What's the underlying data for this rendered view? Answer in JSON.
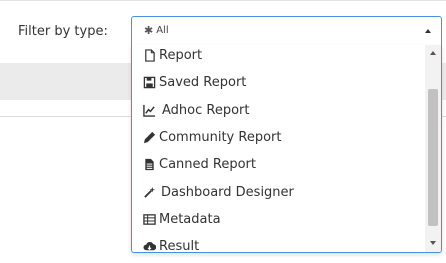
{
  "filter": {
    "label": "Filter by type:",
    "selected": "All",
    "selected_icon": "asterisk-icon"
  },
  "options": [
    {
      "label": "Report",
      "icon": "file-icon"
    },
    {
      "label": "Saved Report",
      "icon": "floppy-disk-icon"
    },
    {
      "label": "Adhoc Report",
      "icon": "line-chart-icon"
    },
    {
      "label": "Community Report",
      "icon": "pencil-icon"
    },
    {
      "label": "Canned Report",
      "icon": "document-icon"
    },
    {
      "label": "Dashboard Designer",
      "icon": "magic-wand-icon"
    },
    {
      "label": "Metadata",
      "icon": "table-icon"
    },
    {
      "label": "Result",
      "icon": "cloud-download-icon"
    }
  ],
  "colors": {
    "focus_border": "#4a90e2",
    "scroll_thumb": "#c1c1c1",
    "band": "#ebebeb"
  }
}
